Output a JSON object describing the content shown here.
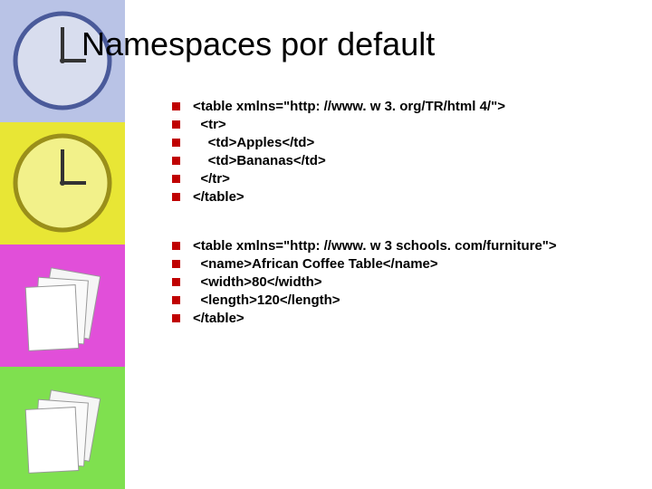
{
  "title": "Namespaces por default",
  "block1": {
    "l0": "<table xmlns=\"http: //www. w 3. org/TR/html 4/\">",
    "l1": "  <tr>",
    "l2": "    <td>Apples</td>",
    "l3": "    <td>Bananas</td>",
    "l4": "  </tr>",
    "l5": "</table>"
  },
  "block2": {
    "l0": "<table xmlns=\"http: //www. w 3 schools. com/furniture\">",
    "l1": "  <name>African Coffee Table</name>",
    "l2": "  <width>80</width>",
    "l3": "  <length>120</length>",
    "l4": "</table>"
  }
}
